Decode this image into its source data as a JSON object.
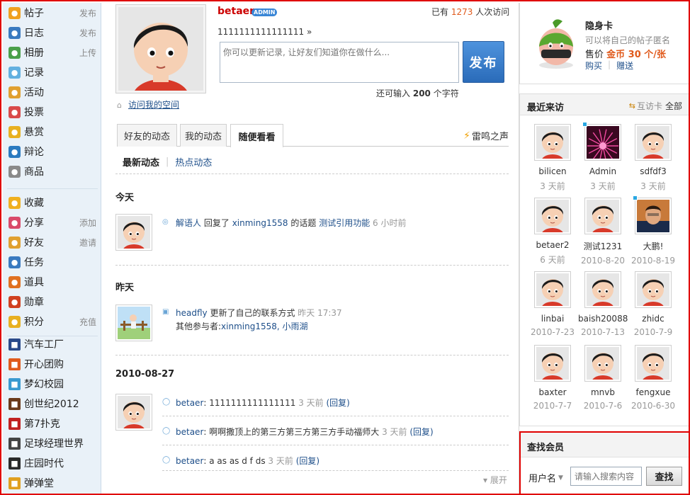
{
  "sidebar": {
    "items": [
      {
        "label": "帖子",
        "sub": "发布",
        "icon": "post-icon",
        "color": "#f0a020"
      },
      {
        "label": "日志",
        "sub": "发布",
        "icon": "blog-icon",
        "color": "#3a7ac0"
      },
      {
        "label": "相册",
        "sub": "上传",
        "icon": "album-icon",
        "color": "#4aa04a"
      },
      {
        "label": "记录",
        "sub": "",
        "icon": "record-icon",
        "color": "#62b0e0"
      },
      {
        "label": "活动",
        "sub": "",
        "icon": "activity-icon",
        "color": "#e0a030"
      },
      {
        "label": "投票",
        "sub": "",
        "icon": "poll-icon",
        "color": "#d94a4a"
      },
      {
        "label": "悬赏",
        "sub": "",
        "icon": "reward-icon",
        "color": "#e8b020"
      },
      {
        "label": "辩论",
        "sub": "",
        "icon": "debate-icon",
        "color": "#2a7ac0"
      },
      {
        "label": "商品",
        "sub": "",
        "icon": "goods-icon",
        "color": "#8a8a8a"
      }
    ],
    "items2": [
      {
        "label": "收藏",
        "sub": "",
        "icon": "favorite-icon",
        "color": "#f0b020"
      },
      {
        "label": "分享",
        "sub": "添加",
        "icon": "share-icon",
        "color": "#d94a6a"
      },
      {
        "label": "好友",
        "sub": "邀请",
        "icon": "friends-icon",
        "color": "#e0a030"
      },
      {
        "label": "任务",
        "sub": "",
        "icon": "task-icon",
        "color": "#3a7ac0"
      },
      {
        "label": "道具",
        "sub": "",
        "icon": "props-icon",
        "color": "#e07020"
      },
      {
        "label": "勋章",
        "sub": "",
        "icon": "medal-icon",
        "color": "#d04020"
      },
      {
        "label": "积分",
        "sub": "充值",
        "icon": "points-icon",
        "color": "#e8b020"
      }
    ],
    "apps": [
      {
        "label": "汽车工厂",
        "icon": "car-factory-icon",
        "color": "#2a4a8a"
      },
      {
        "label": "开心团购",
        "icon": "group-buy-icon",
        "color": "#e05a1c"
      },
      {
        "label": "梦幻校园",
        "icon": "campus-icon",
        "color": "#3a9ad0"
      },
      {
        "label": "创世纪2012",
        "icon": "genesis-icon",
        "color": "#6a3a1a"
      },
      {
        "label": "第7扑克",
        "icon": "poker-icon",
        "color": "#c02020"
      },
      {
        "label": "足球经理世界",
        "icon": "football-icon",
        "color": "#444444"
      },
      {
        "label": "庄园时代",
        "icon": "manor-icon",
        "color": "#2a2a2a"
      },
      {
        "label": "弹弹堂",
        "icon": "ddt-icon",
        "color": "#e0a020"
      }
    ]
  },
  "profile": {
    "username": "betaer",
    "badge": "ADMIN",
    "visits_prefix": "已有",
    "visits_count": "1273",
    "visits_suffix": "人次访问",
    "status": "1111111111111111 »",
    "status_placeholder": "你可以更新记录, 让好友们知道你在做什么...",
    "publish": "发布",
    "chars_prefix": "还可输入",
    "chars_count": "200",
    "chars_suffix": "个字符",
    "visit_space": "访问我的空间"
  },
  "tabs": [
    "好友的动态",
    "我的动态",
    "随便看看"
  ],
  "thunder": "雷鸣之声",
  "subtabs": {
    "latest": "最新动态",
    "hot": "热点动态"
  },
  "feed": {
    "today": "今天",
    "yesterday": "昨天",
    "date": "2010-08-27",
    "item1": {
      "user": "解语人",
      "action": "回复了",
      "target": "xinming1558",
      "mid": "的话题",
      "topic": "测试引用功能",
      "time": "6 小时前"
    },
    "item2": {
      "user": "headfly",
      "action": "更新了自己的联系方式",
      "time": "昨天 17:37",
      "others_label": "其他参与者:",
      "others": "xinming1558, 小雨湖"
    },
    "item3": [
      {
        "user": "betaer",
        "text": ": 1111111111111111",
        "time": "3 天前",
        "reply": "(回复)"
      },
      {
        "user": "betaer",
        "text": ": 啊啊撒顶上的第三方第三方第三方手动福师大",
        "time": "3 天前",
        "reply": "(回复)"
      },
      {
        "user": "betaer",
        "text": ": a as as d f ds",
        "time": "3 天前",
        "reply": "(回复)"
      }
    ],
    "expand": "展开"
  },
  "card": {
    "title": "隐身卡",
    "desc": "可以将自己的帖子匿名",
    "price_label": "售价",
    "price": "金币 30 个/张",
    "buy": "购买",
    "gift": "赠送"
  },
  "visitors": {
    "title": "最近来访",
    "card_link": "互访卡",
    "all": "全部",
    "list": [
      {
        "name": "bilicen",
        "date": "3 天前",
        "online": false,
        "avatar": "default"
      },
      {
        "name": "Admin",
        "date": "3 天前",
        "online": true,
        "avatar": "pink"
      },
      {
        "name": "sdfdf3",
        "date": "3 天前",
        "online": false,
        "avatar": "default"
      },
      {
        "name": "betaer2",
        "date": "6 天前",
        "online": false,
        "avatar": "default"
      },
      {
        "name": "测试1231",
        "date": "2010-8-20",
        "online": false,
        "avatar": "default"
      },
      {
        "name": "大鹏!",
        "date": "2010-8-19",
        "online": true,
        "avatar": "photo"
      },
      {
        "name": "linbai",
        "date": "2010-7-23",
        "online": false,
        "avatar": "default"
      },
      {
        "name": "baish20088",
        "date": "2010-7-13",
        "online": false,
        "avatar": "default"
      },
      {
        "name": "zhidc",
        "date": "2010-7-9",
        "online": false,
        "avatar": "default"
      },
      {
        "name": "baxter",
        "date": "2010-7-7",
        "online": false,
        "avatar": "default"
      },
      {
        "name": "mnvb",
        "date": "2010-7-6",
        "online": false,
        "avatar": "default"
      },
      {
        "name": "fengxue",
        "date": "2010-6-30",
        "online": false,
        "avatar": "default"
      }
    ]
  },
  "search": {
    "title": "查找会员",
    "label": "用户名",
    "placeholder": "请输入搜索内容",
    "button": "查找"
  }
}
